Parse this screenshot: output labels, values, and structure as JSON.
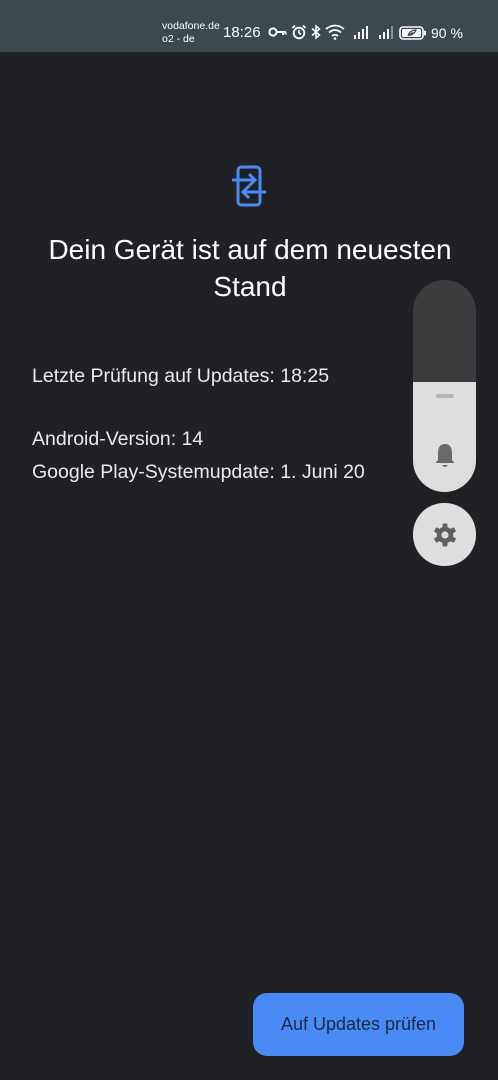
{
  "status_bar": {
    "carrier_1": "vodafone.de",
    "carrier_2": "o2 - de",
    "time": "18:26",
    "battery_percent": "90 %",
    "icons": [
      "key-icon",
      "alarm-icon",
      "bluetooth-icon",
      "wifi-icon",
      "signal-icon",
      "signal-icon",
      "battery-icon"
    ]
  },
  "main": {
    "icon": "system-update-icon",
    "accent_color": "#4a8af4",
    "headline": "Dein Gerät ist auf dem neuesten Stand",
    "last_check": "Letzte Prüfung auf Updates: 18:25",
    "android_version": "Android-Version: 14",
    "play_system_update": "Google Play-Systemupdate: 1. Juni 20"
  },
  "volume_panel": {
    "level_fraction": 0.52,
    "ringer_icon": "bell-icon",
    "settings_icon": "gear-icon"
  },
  "actions": {
    "check_updates_label": "Auf Updates prüfen"
  }
}
